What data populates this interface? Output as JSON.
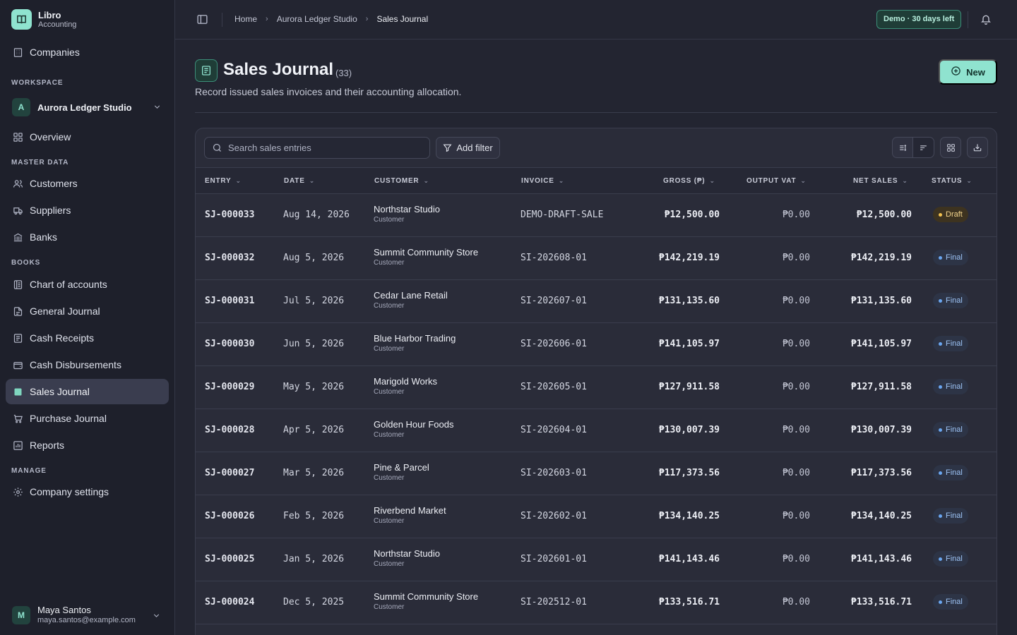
{
  "brand": {
    "name": "Libro",
    "subtitle": "Accounting"
  },
  "sidebar": {
    "companies": "Companies",
    "workspace_label": "WORKSPACE",
    "workspace": {
      "avatar": "A",
      "name": "Aurora Ledger Studio"
    },
    "overview": "Overview",
    "master_data_label": "MASTER DATA",
    "master_data": [
      "Customers",
      "Suppliers",
      "Banks"
    ],
    "books_label": "BOOKS",
    "books": [
      "Chart of accounts",
      "General Journal",
      "Cash Receipts",
      "Cash Disbursements",
      "Sales Journal",
      "Purchase Journal",
      "Reports"
    ],
    "active_item": "Sales Journal",
    "manage_label": "MANAGE",
    "manage": [
      "Company settings"
    ],
    "user": {
      "avatar": "M",
      "name": "Maya Santos",
      "email": "maya.santos@example.com"
    }
  },
  "topbar": {
    "breadcrumb": [
      "Home",
      "Aurora Ledger Studio",
      "Sales Journal"
    ],
    "demo_badge": "Demo · 30 days left"
  },
  "page": {
    "title": "Sales Journal",
    "count": "(33)",
    "description": "Record issued sales invoices and their accounting allocation.",
    "new_button": "New"
  },
  "toolbar": {
    "search_placeholder": "Search sales entries",
    "add_filter": "Add filter"
  },
  "table": {
    "columns": [
      "ENTRY",
      "DATE",
      "CUSTOMER",
      "INVOICE",
      "GROSS (₱)",
      "OUTPUT VAT",
      "NET SALES",
      "STATUS"
    ],
    "rows": [
      {
        "entry": "SJ-000033",
        "date": "Aug 14, 2026",
        "customer": "Northstar Studio",
        "customer_type": "Customer",
        "invoice": "DEMO-DRAFT-SALE",
        "gross": "₱12,500.00",
        "vat": "₱0.00",
        "net": "₱12,500.00",
        "status": "Draft"
      },
      {
        "entry": "SJ-000032",
        "date": "Aug 5, 2026",
        "customer": "Summit Community Store",
        "customer_type": "Customer",
        "invoice": "SI-202608-01",
        "gross": "₱142,219.19",
        "vat": "₱0.00",
        "net": "₱142,219.19",
        "status": "Final"
      },
      {
        "entry": "SJ-000031",
        "date": "Jul 5, 2026",
        "customer": "Cedar Lane Retail",
        "customer_type": "Customer",
        "invoice": "SI-202607-01",
        "gross": "₱131,135.60",
        "vat": "₱0.00",
        "net": "₱131,135.60",
        "status": "Final"
      },
      {
        "entry": "SJ-000030",
        "date": "Jun 5, 2026",
        "customer": "Blue Harbor Trading",
        "customer_type": "Customer",
        "invoice": "SI-202606-01",
        "gross": "₱141,105.97",
        "vat": "₱0.00",
        "net": "₱141,105.97",
        "status": "Final"
      },
      {
        "entry": "SJ-000029",
        "date": "May 5, 2026",
        "customer": "Marigold Works",
        "customer_type": "Customer",
        "invoice": "SI-202605-01",
        "gross": "₱127,911.58",
        "vat": "₱0.00",
        "net": "₱127,911.58",
        "status": "Final"
      },
      {
        "entry": "SJ-000028",
        "date": "Apr 5, 2026",
        "customer": "Golden Hour Foods",
        "customer_type": "Customer",
        "invoice": "SI-202604-01",
        "gross": "₱130,007.39",
        "vat": "₱0.00",
        "net": "₱130,007.39",
        "status": "Final"
      },
      {
        "entry": "SJ-000027",
        "date": "Mar 5, 2026",
        "customer": "Pine & Parcel",
        "customer_type": "Customer",
        "invoice": "SI-202603-01",
        "gross": "₱117,373.56",
        "vat": "₱0.00",
        "net": "₱117,373.56",
        "status": "Final"
      },
      {
        "entry": "SJ-000026",
        "date": "Feb 5, 2026",
        "customer": "Riverbend Market",
        "customer_type": "Customer",
        "invoice": "SI-202602-01",
        "gross": "₱134,140.25",
        "vat": "₱0.00",
        "net": "₱134,140.25",
        "status": "Final"
      },
      {
        "entry": "SJ-000025",
        "date": "Jan 5, 2026",
        "customer": "Northstar Studio",
        "customer_type": "Customer",
        "invoice": "SI-202601-01",
        "gross": "₱141,143.46",
        "vat": "₱0.00",
        "net": "₱141,143.46",
        "status": "Final"
      },
      {
        "entry": "SJ-000024",
        "date": "Dec 5, 2025",
        "customer": "Summit Community Store",
        "customer_type": "Customer",
        "invoice": "SI-202512-01",
        "gross": "₱133,516.71",
        "vat": "₱0.00",
        "net": "₱133,516.71",
        "status": "Final"
      }
    ]
  },
  "colors": {
    "accent": "#8fe3cf",
    "background": "#232531",
    "sidebar": "#1e202b",
    "draft": "#f2c14e",
    "final": "#6aa6f0"
  }
}
